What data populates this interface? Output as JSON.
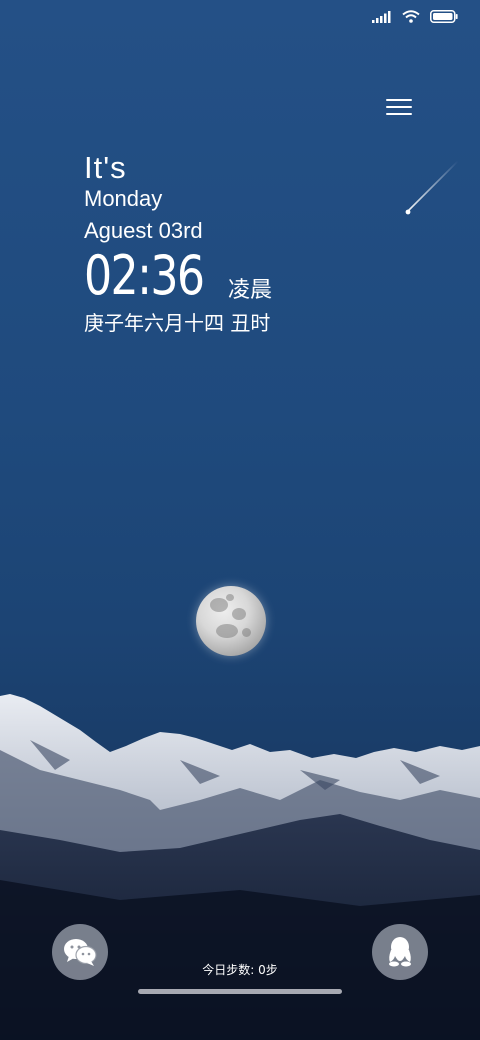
{
  "status_bar": {
    "signal_icon": "signal-icon",
    "wifi_icon": "wifi-icon",
    "battery_icon": "battery-icon"
  },
  "header": {
    "menu_icon": "menu-icon"
  },
  "greeting": {
    "its": "It's",
    "day": "Monday",
    "date": "Aguest 03rd"
  },
  "clock": {
    "time": "02:36",
    "period": "凌晨",
    "lunar": "庚子年六月十四 丑时"
  },
  "footer": {
    "left_icon": "wechat-icon",
    "right_icon": "qq-icon",
    "steps": "今日步数: 0步"
  },
  "colors": {
    "sky_top": "#245086",
    "sky_mid": "#1c4474",
    "ground": "#101d33"
  }
}
